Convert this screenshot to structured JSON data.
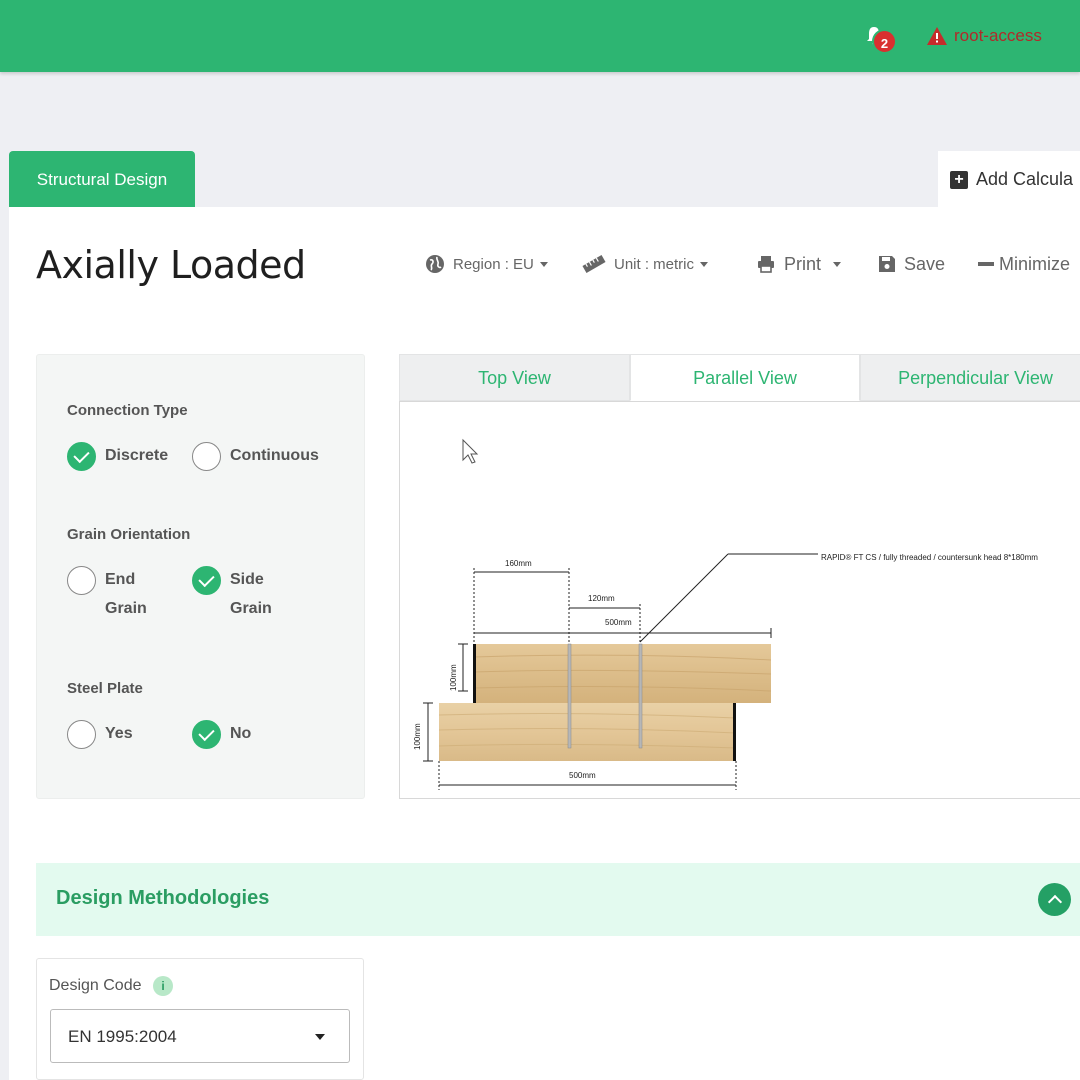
{
  "header": {
    "notification_count": "2",
    "alert_label": "root-access"
  },
  "tabs": {
    "main_tab": "Structural Design",
    "add_tab": "Add Calcula"
  },
  "page": {
    "title": "Axially Loaded"
  },
  "toolbar": {
    "region": "Region : EU",
    "unit": "Unit : metric",
    "print": "Print",
    "save": "Save",
    "minimize": "Minimize"
  },
  "options": {
    "connection_type": {
      "heading": "Connection Type",
      "choices": [
        "Discrete",
        "Continuous"
      ],
      "selected": "Discrete"
    },
    "grain_orientation": {
      "heading": "Grain Orientation",
      "choice_1_line1": "End",
      "choice_1_line2": "Grain",
      "choice_2_line1": "Side",
      "choice_2_line2": "Grain",
      "selected": "Side Grain"
    },
    "steel_plate": {
      "heading": "Steel Plate",
      "choices": [
        "Yes",
        "No"
      ],
      "selected": "No"
    }
  },
  "views": {
    "tabs": [
      "Top View",
      "Parallel View",
      "Perpendicular View"
    ],
    "active": "Parallel View"
  },
  "drawing": {
    "callout": "RAPID® FT CS / fully threaded / countersunk head 8*180mm",
    "dim_160": "160mm",
    "dim_120": "120mm",
    "dim_500_top": "500mm",
    "dim_100_upper": "100mm",
    "dim_100_lower": "100mm",
    "dim_500_bottom": "500mm"
  },
  "design": {
    "section_title": "Design Methodologies",
    "code_label": "Design Code",
    "info_glyph": "i",
    "code_value": "EN 1995:2004"
  },
  "colors": {
    "brand_green": "#2db572",
    "alert_red": "#d9302f",
    "section_bg": "#e3faef"
  }
}
